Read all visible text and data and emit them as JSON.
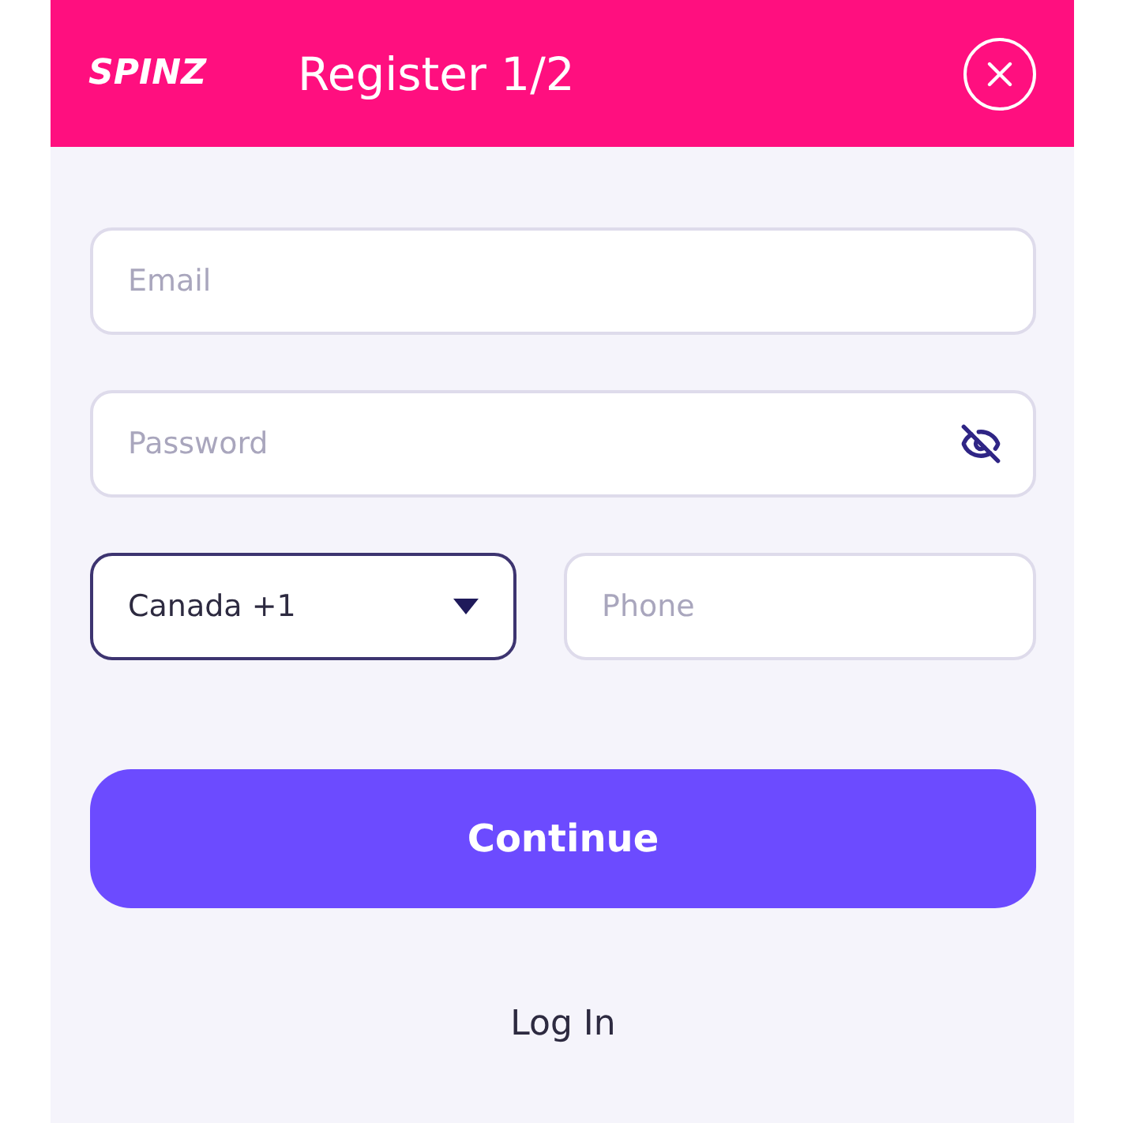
{
  "header": {
    "logo": "SPINZ",
    "title": "Register 1/2"
  },
  "email": {
    "placeholder": "Email"
  },
  "password": {
    "placeholder": "Password"
  },
  "country": {
    "value": "Canada +1"
  },
  "phone": {
    "placeholder": "Phone"
  },
  "continue_button": "Continue",
  "login_link": "Log In"
}
